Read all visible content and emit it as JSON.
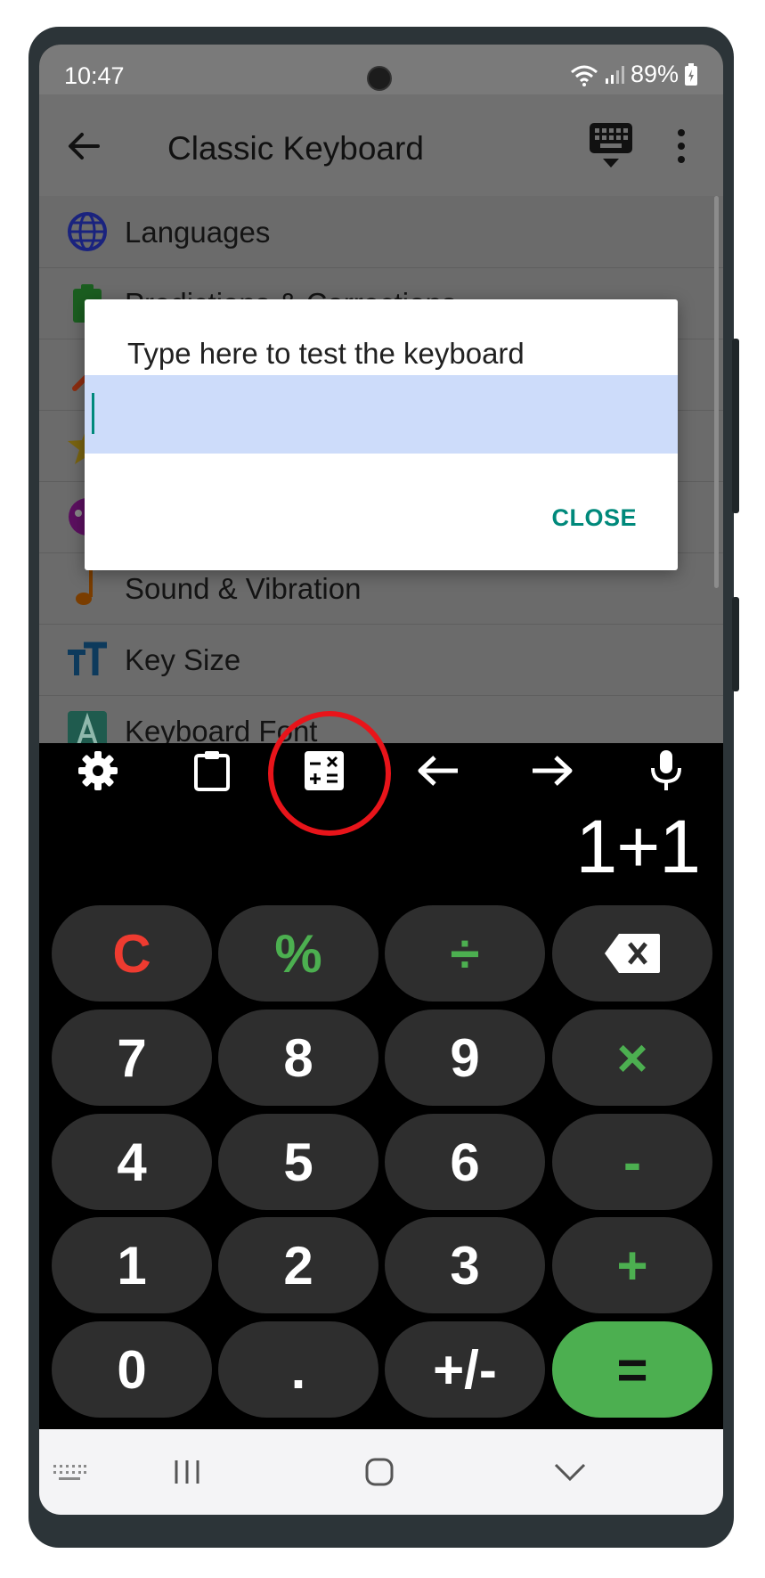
{
  "status_bar": {
    "time": "10:47",
    "battery": "89%"
  },
  "app_bar": {
    "title": "Classic Keyboard"
  },
  "settings_items": [
    {
      "label": "Languages",
      "icon": "globe-icon"
    },
    {
      "label": "Predictions & Corrections",
      "icon": "clipboard-check-icon"
    },
    {
      "label": "",
      "icon": "hammer-icon"
    },
    {
      "label": "",
      "icon": "star-icon"
    },
    {
      "label": "",
      "icon": "palette-icon"
    },
    {
      "label": "Sound & Vibration",
      "icon": "music-note-icon"
    },
    {
      "label": "Key Size",
      "icon": "text-size-icon"
    },
    {
      "label": "Keyboard Font",
      "icon": "font-icon"
    }
  ],
  "dialog": {
    "title": "Type here to test the keyboard",
    "input_value": "",
    "close_label": "CLOSE"
  },
  "toolbar": {
    "items": [
      "settings-gear-icon",
      "clipboard-icon",
      "calculator-icon",
      "arrow-left-icon",
      "arrow-right-icon",
      "microphone-icon"
    ]
  },
  "calculator": {
    "display": "1+1",
    "keys": [
      [
        "C",
        "%",
        "÷",
        "⌫"
      ],
      [
        "7",
        "8",
        "9",
        "×"
      ],
      [
        "4",
        "5",
        "6",
        "-"
      ],
      [
        "1",
        "2",
        "3",
        "+"
      ],
      [
        "0",
        ".",
        "+/-",
        "="
      ]
    ]
  },
  "colors": {
    "accent_teal": "#00897b",
    "key_green": "#4caf50",
    "key_red": "#ee3b30",
    "highlight_red": "#e8141a",
    "input_bg": "#cddcfa"
  }
}
